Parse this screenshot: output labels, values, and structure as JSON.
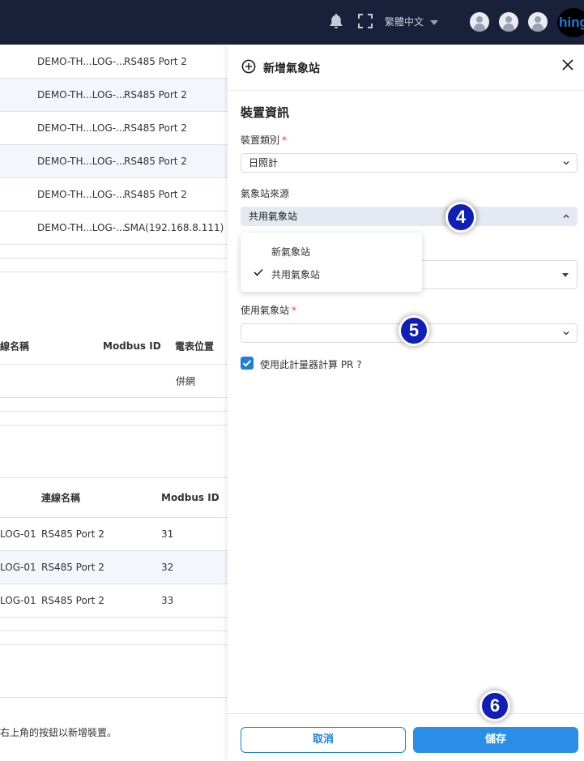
{
  "topbar": {
    "language": "繁體中文",
    "logo_text": "hing"
  },
  "background": {
    "table1": [
      {
        "device": "DEMO-TH...LOG-...",
        "port": "RS485 Port 2"
      },
      {
        "device": "DEMO-TH...LOG-...",
        "port": "RS485 Port 2"
      },
      {
        "device": "DEMO-TH...LOG-...",
        "port": "RS485 Port 2"
      },
      {
        "device": "DEMO-TH...LOG-...",
        "port": "RS485 Port 2"
      },
      {
        "device": "DEMO-TH...LOG-...",
        "port": "RS485 Port 2"
      },
      {
        "device": "DEMO-TH...LOG-...",
        "port": "SMA(192.168.8.111)"
      }
    ],
    "table2": {
      "headers": [
        "連線名稱",
        "Modbus ID",
        "電表位置"
      ],
      "row": {
        "location": "併網"
      }
    },
    "table3": {
      "headers": [
        "連線名稱",
        "Modbus ID"
      ],
      "rows": [
        {
          "device": "LOG-01",
          "port": "RS485 Port 2",
          "modbus_id": "31"
        },
        {
          "device": "LOG-01",
          "port": "RS485 Port 2",
          "modbus_id": "32"
        },
        {
          "device": "LOG-01",
          "port": "RS485 Port 2",
          "modbus_id": "33"
        }
      ]
    },
    "hint": "右上角的按鈕以新增裝置。"
  },
  "drawer": {
    "title": "新增氣象站",
    "section_title": "裝置資訊",
    "device_type": {
      "label": "裝置類別",
      "value": "日照計"
    },
    "station_source": {
      "label": "氣象站來源",
      "value": "共用氣象站",
      "options": [
        "新氣象站",
        "共用氣象站"
      ]
    },
    "use_station": {
      "label": "使用氣象站",
      "value": ""
    },
    "use_pr_checkbox": {
      "label": "使用此計量器計算 PR ?",
      "checked": true
    },
    "cancel_label": "取消",
    "save_label": "儲存"
  },
  "steps": [
    "4",
    "5",
    "6"
  ],
  "colors": {
    "topbar": "#19203a",
    "primary": "#2a8ee8",
    "step_badge": "#0f1fb8",
    "required": "#e0463e"
  }
}
